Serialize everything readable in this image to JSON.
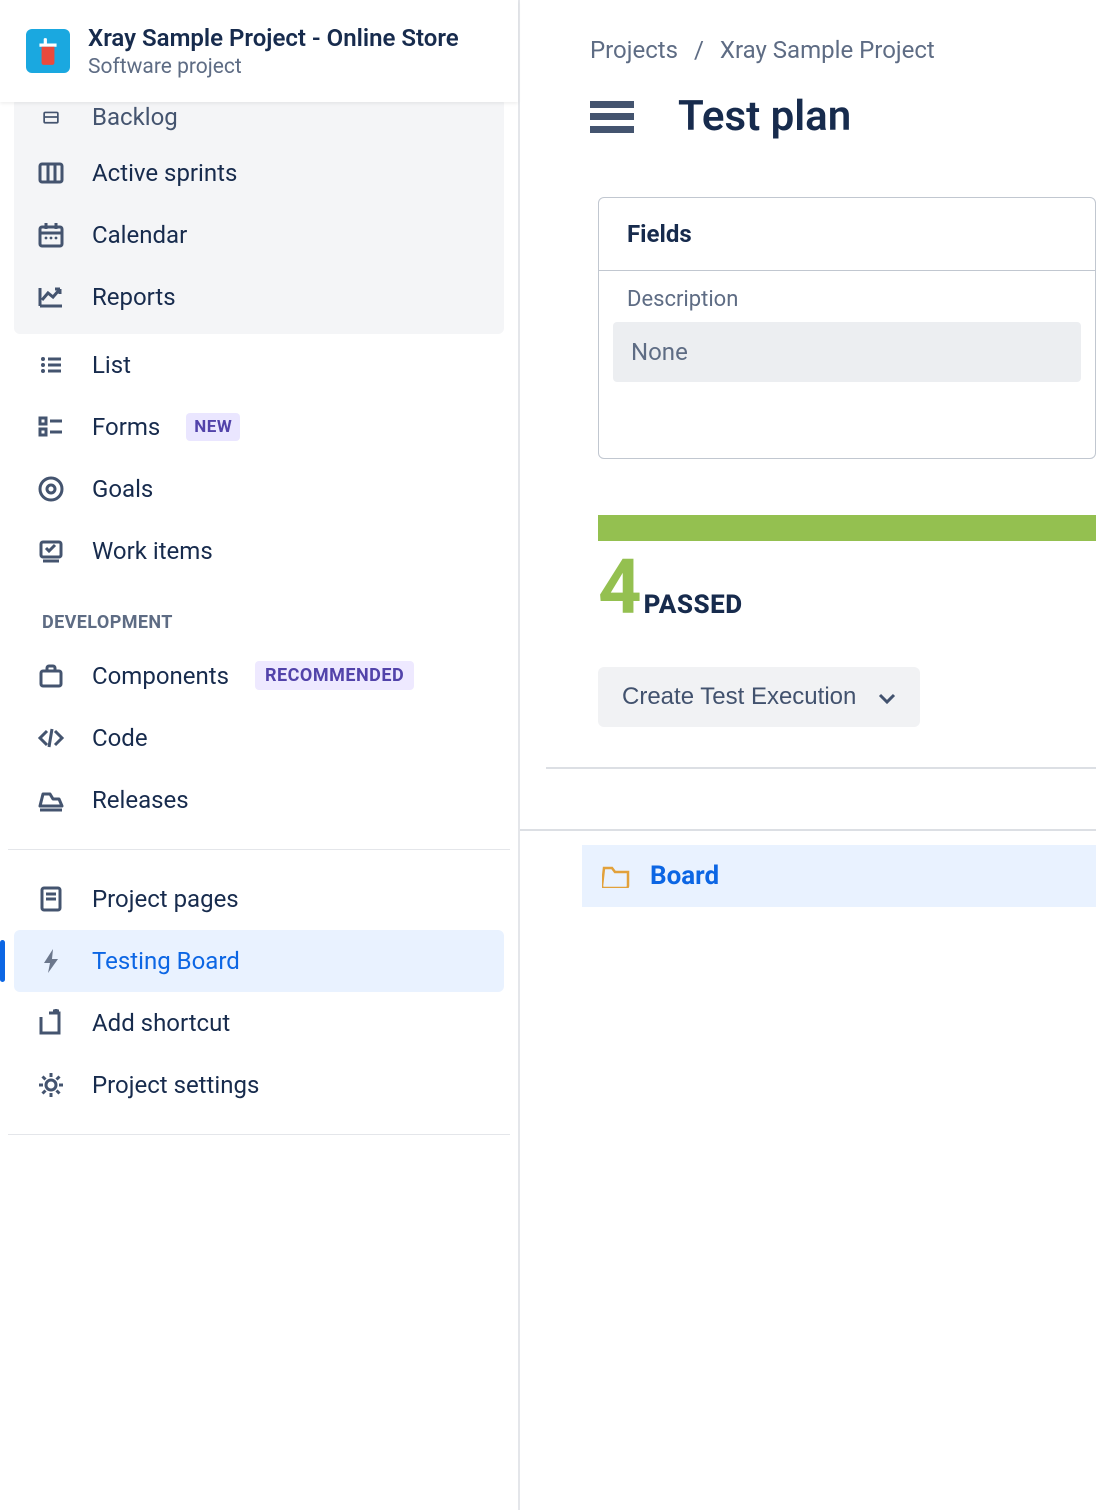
{
  "project": {
    "name": "Xray Sample Project - Online Store",
    "type": "Software project"
  },
  "sidebar": {
    "items": [
      {
        "id": "backlog",
        "label": "Backlog",
        "truncated": true
      },
      {
        "id": "active-sprints",
        "label": "Active sprints"
      },
      {
        "id": "calendar",
        "label": "Calendar"
      },
      {
        "id": "reports",
        "label": "Reports"
      },
      {
        "id": "list",
        "label": "List"
      },
      {
        "id": "forms",
        "label": "Forms",
        "badge": "NEW"
      },
      {
        "id": "goals",
        "label": "Goals"
      },
      {
        "id": "work-items",
        "label": "Work items"
      }
    ],
    "devHeader": "DEVELOPMENT",
    "devItems": [
      {
        "id": "components",
        "label": "Components",
        "badge": "RECOMMENDED"
      },
      {
        "id": "code",
        "label": "Code"
      },
      {
        "id": "releases",
        "label": "Releases"
      }
    ],
    "bottomItems": [
      {
        "id": "project-pages",
        "label": "Project pages"
      },
      {
        "id": "testing-board",
        "label": "Testing Board",
        "selected": true
      },
      {
        "id": "add-shortcut",
        "label": "Add shortcut"
      },
      {
        "id": "project-settings",
        "label": "Project settings"
      }
    ]
  },
  "breadcrumb": {
    "projects": "Projects",
    "project": "Xray Sample Project"
  },
  "main": {
    "title": "Test plan",
    "fieldsHeader": "Fields",
    "descriptionLabel": "Description",
    "descriptionValue": "None",
    "passedCount": "4",
    "passedLabel": "PASSED",
    "createExecLabel": "Create Test Execution",
    "boardLabel": "Board"
  }
}
